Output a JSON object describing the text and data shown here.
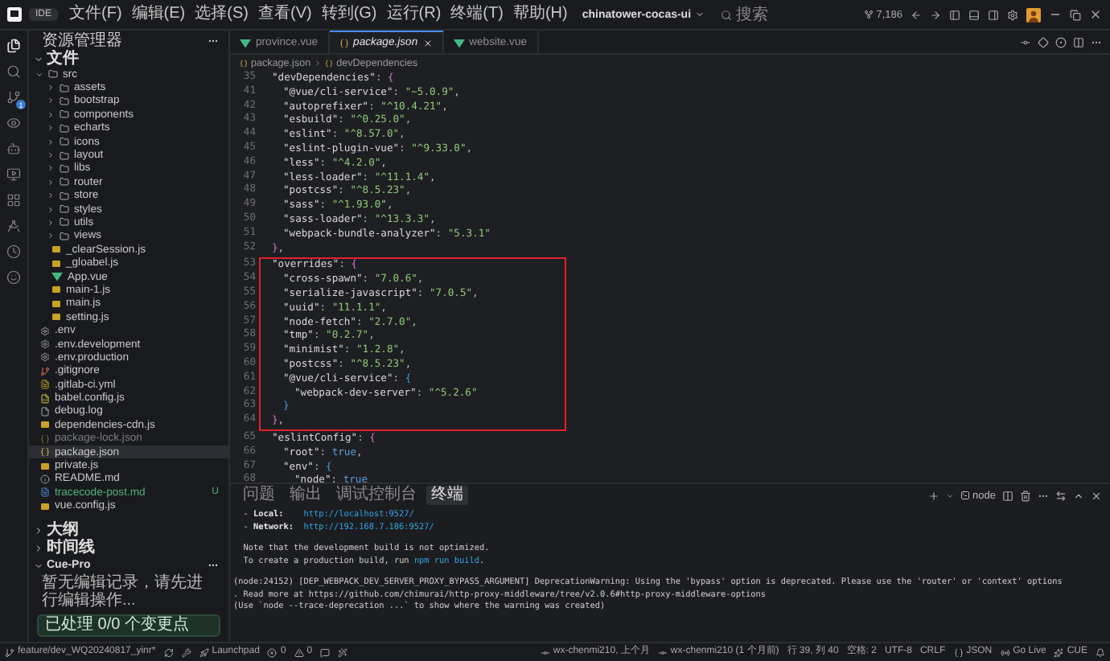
{
  "title_bar": {
    "badge": "IDE",
    "menus": [
      "文件(F)",
      "编辑(E)",
      "选择(S)",
      "查看(V)",
      "转到(G)",
      "运行(R)",
      "终端(T)",
      "帮助(H)"
    ],
    "project": "chinatower-cocas-ui",
    "search_placeholder": "搜索",
    "counter": "7,186"
  },
  "activity_bar": {
    "badge": "1",
    "items": [
      {
        "kind": "files",
        "selected": true
      },
      {
        "kind": "search",
        "selected": false
      },
      {
        "kind": "branch",
        "selected": false
      },
      {
        "kind": "eye",
        "selected": false
      },
      {
        "kind": "bot",
        "selected": false
      },
      {
        "kind": "monitor",
        "selected": false
      },
      {
        "kind": "grid",
        "selected": false
      },
      {
        "kind": "compass",
        "selected": false
      },
      {
        "kind": "clock",
        "selected": false
      },
      {
        "kind": "smile",
        "selected": false
      }
    ]
  },
  "sidebar": {
    "title": "资源管理器",
    "explorer": {
      "label": "文件",
      "expanded": true,
      "items": [
        {
          "name": "src",
          "kind": "folder",
          "expanded": true,
          "selected": false,
          "dimmed": false,
          "children": [
            {
              "name": "assets",
              "kind": "folder",
              "expanded": false,
              "selected": false,
              "dimmed": false
            },
            {
              "name": "bootstrap",
              "kind": "folder",
              "expanded": false,
              "selected": false,
              "dimmed": false
            },
            {
              "name": "components",
              "kind": "folder",
              "expanded": false,
              "selected": false,
              "dimmed": false
            },
            {
              "name": "echarts",
              "kind": "folder",
              "expanded": false,
              "selected": false,
              "dimmed": false
            },
            {
              "name": "icons",
              "kind": "folder",
              "expanded": false,
              "selected": false,
              "dimmed": false
            },
            {
              "name": "layout",
              "kind": "folder",
              "expanded": false,
              "selected": false,
              "dimmed": false
            },
            {
              "name": "libs",
              "kind": "folder",
              "expanded": false,
              "selected": false,
              "dimmed": false
            },
            {
              "name": "router",
              "kind": "folder",
              "expanded": false,
              "selected": false,
              "dimmed": false
            },
            {
              "name": "store",
              "kind": "folder",
              "expanded": false,
              "selected": false,
              "dimmed": false
            },
            {
              "name": "styles",
              "kind": "folder",
              "expanded": false,
              "selected": false,
              "dimmed": false
            },
            {
              "name": "utils",
              "kind": "folder",
              "expanded": false,
              "selected": false,
              "dimmed": false
            },
            {
              "name": "views",
              "kind": "folder",
              "expanded": false,
              "selected": false,
              "dimmed": false
            },
            {
              "name": "_clearSession.js",
              "kind": "js",
              "selected": false,
              "dimmed": false
            },
            {
              "name": "_gloabel.js",
              "kind": "js",
              "selected": false,
              "dimmed": false
            },
            {
              "name": "App.vue",
              "kind": "vue",
              "selected": false,
              "dimmed": false
            },
            {
              "name": "main-1.js",
              "kind": "js",
              "selected": false,
              "dimmed": false
            },
            {
              "name": "main.js",
              "kind": "js",
              "selected": false,
              "dimmed": false
            },
            {
              "name": "setting.js",
              "kind": "js",
              "selected": false,
              "dimmed": false
            }
          ]
        },
        {
          "name": ".env",
          "kind": "env",
          "selected": false,
          "dimmed": false
        },
        {
          "name": ".env.development",
          "kind": "env",
          "selected": false,
          "dimmed": false
        },
        {
          "name": ".env.production",
          "kind": "env",
          "selected": false,
          "dimmed": false
        },
        {
          "name": ".gitignore",
          "kind": "git",
          "selected": false,
          "dimmed": false
        },
        {
          "name": ".gitlab-ci.yml",
          "kind": "yaml",
          "selected": false,
          "dimmed": false
        },
        {
          "name": "babel.config.js",
          "kind": "babel",
          "selected": false,
          "dimmed": false
        },
        {
          "name": "debug.log",
          "kind": "log",
          "selected": false,
          "dimmed": false
        },
        {
          "name": "dependencies-cdn.js",
          "kind": "js",
          "selected": false,
          "dimmed": false
        },
        {
          "name": "package-lock.json",
          "kind": "json",
          "selected": false,
          "dimmed": true
        },
        {
          "name": "package.json",
          "kind": "json",
          "selected": true,
          "dimmed": false
        },
        {
          "name": "private.js",
          "kind": "js",
          "selected": false,
          "dimmed": false
        },
        {
          "name": "README.md",
          "kind": "info",
          "selected": false,
          "dimmed": false
        },
        {
          "name": "tracecode-post.md",
          "kind": "md",
          "selected": false,
          "dimmed": false,
          "git_status": "U"
        },
        {
          "name": "vue.config.js",
          "kind": "js",
          "selected": false,
          "dimmed": false
        }
      ]
    },
    "outline": {
      "label": "大纲",
      "expanded": false
    },
    "timeline": {
      "label": "时间线",
      "expanded": false
    },
    "cue_pro": {
      "label": "Cue-Pro",
      "expanded": true,
      "message": "暂无编辑记录，请先进行编辑操作...",
      "status": "已处理 0/0 个变更点"
    }
  },
  "editor": {
    "tabs": [
      {
        "label": "province.vue",
        "kind": "vue",
        "selected": false
      },
      {
        "label": "package.json",
        "kind": "json",
        "selected": true
      },
      {
        "label": "website.vue",
        "kind": "vue",
        "selected": false
      }
    ],
    "breadcrumb": [
      "package.json",
      "devDependencies"
    ],
    "lines": [
      {
        "no": "35",
        "boxed": false,
        "tokens": [
          {
            "kind": "key",
            "text": "\"devDependencies\""
          },
          {
            "kind": "punct",
            "text": ":"
          },
          {
            "kind": "brace",
            "text": "{"
          }
        ],
        "children": [
          {
            "no": "41",
            "boxed": false,
            "tokens": [
              {
                "kind": "key",
                "text": "\"@vue/cli-service\""
              },
              {
                "kind": "punct",
                "text": ":"
              },
              {
                "kind": "string",
                "text": "\"~5.0.9\""
              },
              {
                "kind": "punct",
                "text": ","
              }
            ]
          },
          {
            "no": "42",
            "boxed": false,
            "tokens": [
              {
                "kind": "key",
                "text": "\"autoprefixer\""
              },
              {
                "kind": "punct",
                "text": ":"
              },
              {
                "kind": "string",
                "text": "\"^10.4.21\""
              },
              {
                "kind": "punct",
                "text": ","
              }
            ]
          },
          {
            "no": "43",
            "boxed": false,
            "tokens": [
              {
                "kind": "key",
                "text": "\"esbuild\""
              },
              {
                "kind": "punct",
                "text": ":"
              },
              {
                "kind": "string",
                "text": "\"^0.25.0\""
              },
              {
                "kind": "punct",
                "text": ","
              }
            ]
          },
          {
            "no": "44",
            "boxed": false,
            "tokens": [
              {
                "kind": "key",
                "text": "\"eslint\""
              },
              {
                "kind": "punct",
                "text": ":"
              },
              {
                "kind": "string",
                "text": "\"^8.57.0\""
              },
              {
                "kind": "punct",
                "text": ","
              }
            ]
          },
          {
            "no": "45",
            "boxed": false,
            "tokens": [
              {
                "kind": "key",
                "text": "\"eslint-plugin-vue\""
              },
              {
                "kind": "punct",
                "text": ":"
              },
              {
                "kind": "string",
                "text": "\"^9.33.0\""
              },
              {
                "kind": "punct",
                "text": ","
              }
            ]
          },
          {
            "no": "46",
            "boxed": false,
            "tokens": [
              {
                "kind": "key",
                "text": "\"less\""
              },
              {
                "kind": "punct",
                "text": ":"
              },
              {
                "kind": "string",
                "text": "\"^4.2.0\""
              },
              {
                "kind": "punct",
                "text": ","
              }
            ]
          },
          {
            "no": "47",
            "boxed": false,
            "tokens": [
              {
                "kind": "key",
                "text": "\"less-loader\""
              },
              {
                "kind": "punct",
                "text": ":"
              },
              {
                "kind": "string",
                "text": "\"^11.1.4\""
              },
              {
                "kind": "punct",
                "text": ","
              }
            ]
          },
          {
            "no": "48",
            "boxed": false,
            "tokens": [
              {
                "kind": "key",
                "text": "\"postcss\""
              },
              {
                "kind": "punct",
                "text": ":"
              },
              {
                "kind": "string",
                "text": "\"^8.5.23\""
              },
              {
                "kind": "punct",
                "text": ","
              }
            ]
          },
          {
            "no": "49",
            "boxed": false,
            "tokens": [
              {
                "kind": "key",
                "text": "\"sass\""
              },
              {
                "kind": "punct",
                "text": ":"
              },
              {
                "kind": "string",
                "text": "\"^1.93.0\""
              },
              {
                "kind": "punct",
                "text": ","
              }
            ]
          },
          {
            "no": "50",
            "boxed": false,
            "tokens": [
              {
                "kind": "key",
                "text": "\"sass-loader\""
              },
              {
                "kind": "punct",
                "text": ":"
              },
              {
                "kind": "string",
                "text": "\"^13.3.3\""
              },
              {
                "kind": "punct",
                "text": ","
              }
            ]
          },
          {
            "no": "51",
            "boxed": false,
            "tokens": [
              {
                "kind": "key",
                "text": "\"webpack-bundle-analyzer\""
              },
              {
                "kind": "punct",
                "text": ":"
              },
              {
                "kind": "string",
                "text": "\"5.3.1\""
              }
            ]
          }
        ]
      },
      {
        "no": "52",
        "boxed": false,
        "tokens": [
          {
            "kind": "brace",
            "text": "}"
          },
          {
            "kind": "punct",
            "text": ","
          }
        ]
      },
      {
        "no": "53",
        "boxed": true,
        "tokens": [
          {
            "kind": "key",
            "text": "\"overrides\""
          },
          {
            "kind": "punct",
            "text": ":"
          },
          {
            "kind": "brace",
            "text": "{"
          }
        ],
        "children": [
          {
            "no": "54",
            "boxed": true,
            "tokens": [
              {
                "kind": "key",
                "text": "\"cross-spawn\""
              },
              {
                "kind": "punct",
                "text": ":"
              },
              {
                "kind": "string",
                "text": "\"7.0.6\""
              },
              {
                "kind": "punct",
                "text": ","
              }
            ]
          },
          {
            "no": "55",
            "boxed": true,
            "tokens": [
              {
                "kind": "key",
                "text": "\"serialize-javascript\""
              },
              {
                "kind": "punct",
                "text": ":"
              },
              {
                "kind": "string",
                "text": "\"7.0.5\""
              },
              {
                "kind": "punct",
                "text": ","
              }
            ]
          },
          {
            "no": "56",
            "boxed": true,
            "tokens": [
              {
                "kind": "key",
                "text": "\"uuid\""
              },
              {
                "kind": "punct",
                "text": ":"
              },
              {
                "kind": "string",
                "text": "\"11.1.1\""
              },
              {
                "kind": "punct",
                "text": ","
              }
            ]
          },
          {
            "no": "57",
            "boxed": true,
            "tokens": [
              {
                "kind": "key",
                "text": "\"node-fetch\""
              },
              {
                "kind": "punct",
                "text": ":"
              },
              {
                "kind": "string",
                "text": "\"2.7.0\""
              },
              {
                "kind": "punct",
                "text": ","
              }
            ]
          },
          {
            "no": "58",
            "boxed": true,
            "tokens": [
              {
                "kind": "key",
                "text": "\"tmp\""
              },
              {
                "kind": "punct",
                "text": ":"
              },
              {
                "kind": "string",
                "text": "\"0.2.7\""
              },
              {
                "kind": "punct",
                "text": ","
              }
            ]
          },
          {
            "no": "59",
            "boxed": true,
            "tokens": [
              {
                "kind": "key",
                "text": "\"minimist\""
              },
              {
                "kind": "punct",
                "text": ":"
              },
              {
                "kind": "string",
                "text": "\"1.2.8\""
              },
              {
                "kind": "punct",
                "text": ","
              }
            ]
          },
          {
            "no": "60",
            "boxed": true,
            "tokens": [
              {
                "kind": "key",
                "text": "\"postcss\""
              },
              {
                "kind": "punct",
                "text": ":"
              },
              {
                "kind": "string",
                "text": "\"^8.5.23\""
              },
              {
                "kind": "punct",
                "text": ","
              }
            ]
          },
          {
            "no": "61",
            "boxed": true,
            "tokens": [
              {
                "kind": "key",
                "text": "\"@vue/cli-service\""
              },
              {
                "kind": "punct",
                "text": ":"
              },
              {
                "kind": "brace2",
                "text": "{"
              }
            ],
            "children": [
              {
                "no": "62",
                "boxed": true,
                "tokens": [
                  {
                    "kind": "key",
                    "text": "\"webpack-dev-server\""
                  },
                  {
                    "kind": "punct",
                    "text": ":"
                  },
                  {
                    "kind": "string",
                    "text": "\"^5.2.6\""
                  }
                ]
              }
            ]
          },
          {
            "no": "63",
            "boxed": true,
            "tokens": [
              {
                "kind": "brace2",
                "text": "}"
              }
            ]
          }
        ]
      },
      {
        "no": "64",
        "boxed": true,
        "tokens": [
          {
            "kind": "brace",
            "text": "}"
          },
          {
            "kind": "punct",
            "text": ","
          }
        ]
      },
      {
        "no": "65",
        "boxed": false,
        "tokens": [
          {
            "kind": "key",
            "text": "\"eslintConfig\""
          },
          {
            "kind": "punct",
            "text": ":"
          },
          {
            "kind": "brace",
            "text": "{"
          }
        ],
        "children": [
          {
            "no": "66",
            "boxed": false,
            "tokens": [
              {
                "kind": "key",
                "text": "\"root\""
              },
              {
                "kind": "punct",
                "text": ":"
              },
              {
                "kind": "bool",
                "text": "true"
              },
              {
                "kind": "punct",
                "text": ","
              }
            ]
          },
          {
            "no": "67",
            "boxed": false,
            "tokens": [
              {
                "kind": "key",
                "text": "\"env\""
              },
              {
                "kind": "punct",
                "text": ":"
              },
              {
                "kind": "brace2",
                "text": "{"
              }
            ],
            "children": [
              {
                "no": "68",
                "boxed": false,
                "tokens": [
                  {
                    "kind": "key",
                    "text": "\"node\""
                  },
                  {
                    "kind": "punct",
                    "text": ":"
                  },
                  {
                    "kind": "bool",
                    "text": "true"
                  }
                ]
              }
            ]
          }
        ]
      }
    ]
  },
  "panel": {
    "tabs": [
      {
        "label": "问题",
        "selected": false
      },
      {
        "label": "输出",
        "selected": false
      },
      {
        "label": "调试控制台",
        "selected": false
      },
      {
        "label": "终端",
        "selected": true
      }
    ],
    "shell": "node",
    "blocks": [
      [
        [
          {
            "kind": "text",
            "text": "  - "
          },
          {
            "kind": "label",
            "text": "Local:"
          },
          {
            "kind": "link",
            "text": "http://localhost:9527/"
          }
        ],
        [
          {
            "kind": "text",
            "text": "  - "
          },
          {
            "kind": "label",
            "text": "Network:"
          },
          {
            "kind": "link",
            "text": "http://192.168.7.186:9527/"
          }
        ]
      ],
      [
        [
          {
            "kind": "text",
            "text": "  Note that the development build is not optimized."
          }
        ],
        [
          {
            "kind": "text",
            "text": "  To create a production build, run "
          },
          {
            "kind": "link",
            "text": "npm run build"
          },
          {
            "kind": "text",
            "text": "."
          }
        ]
      ],
      [
        [
          {
            "kind": "text",
            "text": "(node:24152) [DEP_WEBPACK_DEV_SERVER_PROXY_BYPASS_ARGUMENT] DeprecationWarning: Using the 'bypass' option is deprecated. Please use the 'router' or 'context' options"
          }
        ],
        [
          {
            "kind": "text",
            "text": ". Read more at https://github.com/chimurai/http-proxy-middleware/tree/v2.0.6#http-proxy-middleware-options"
          }
        ],
        [
          {
            "kind": "text",
            "text": "(Use `node --trace-deprecation ...` to show where the warning was created)"
          }
        ]
      ]
    ]
  },
  "status_bar": {
    "left": [
      {
        "kind": "branch",
        "text": "feature/dev_WQ20240817_yinr*"
      },
      {
        "kind": "sync"
      },
      {
        "kind": "tools"
      },
      {
        "kind": "rocket",
        "text": "Launchpad"
      },
      {
        "kind": "error",
        "text": "0"
      },
      {
        "kind": "warning",
        "text": "0"
      },
      {
        "kind": "chat"
      },
      {
        "kind": "wand"
      }
    ],
    "right": [
      {
        "kind": "commit",
        "text": "wx-chenmi210, 上个月"
      },
      {
        "kind": "commit",
        "text": "wx-chenmi210 (1 个月前)"
      },
      {
        "kind": "plain",
        "text": "行 39, 列 40"
      },
      {
        "kind": "plain",
        "text": "空格: 2"
      },
      {
        "kind": "plain",
        "text": "UTF-8"
      },
      {
        "kind": "plain",
        "text": "CRLF"
      },
      {
        "kind": "json",
        "text": "JSON"
      },
      {
        "kind": "live",
        "text": "Go Live"
      },
      {
        "kind": "cue",
        "text": "CUE"
      },
      {
        "kind": "bell"
      }
    ]
  }
}
